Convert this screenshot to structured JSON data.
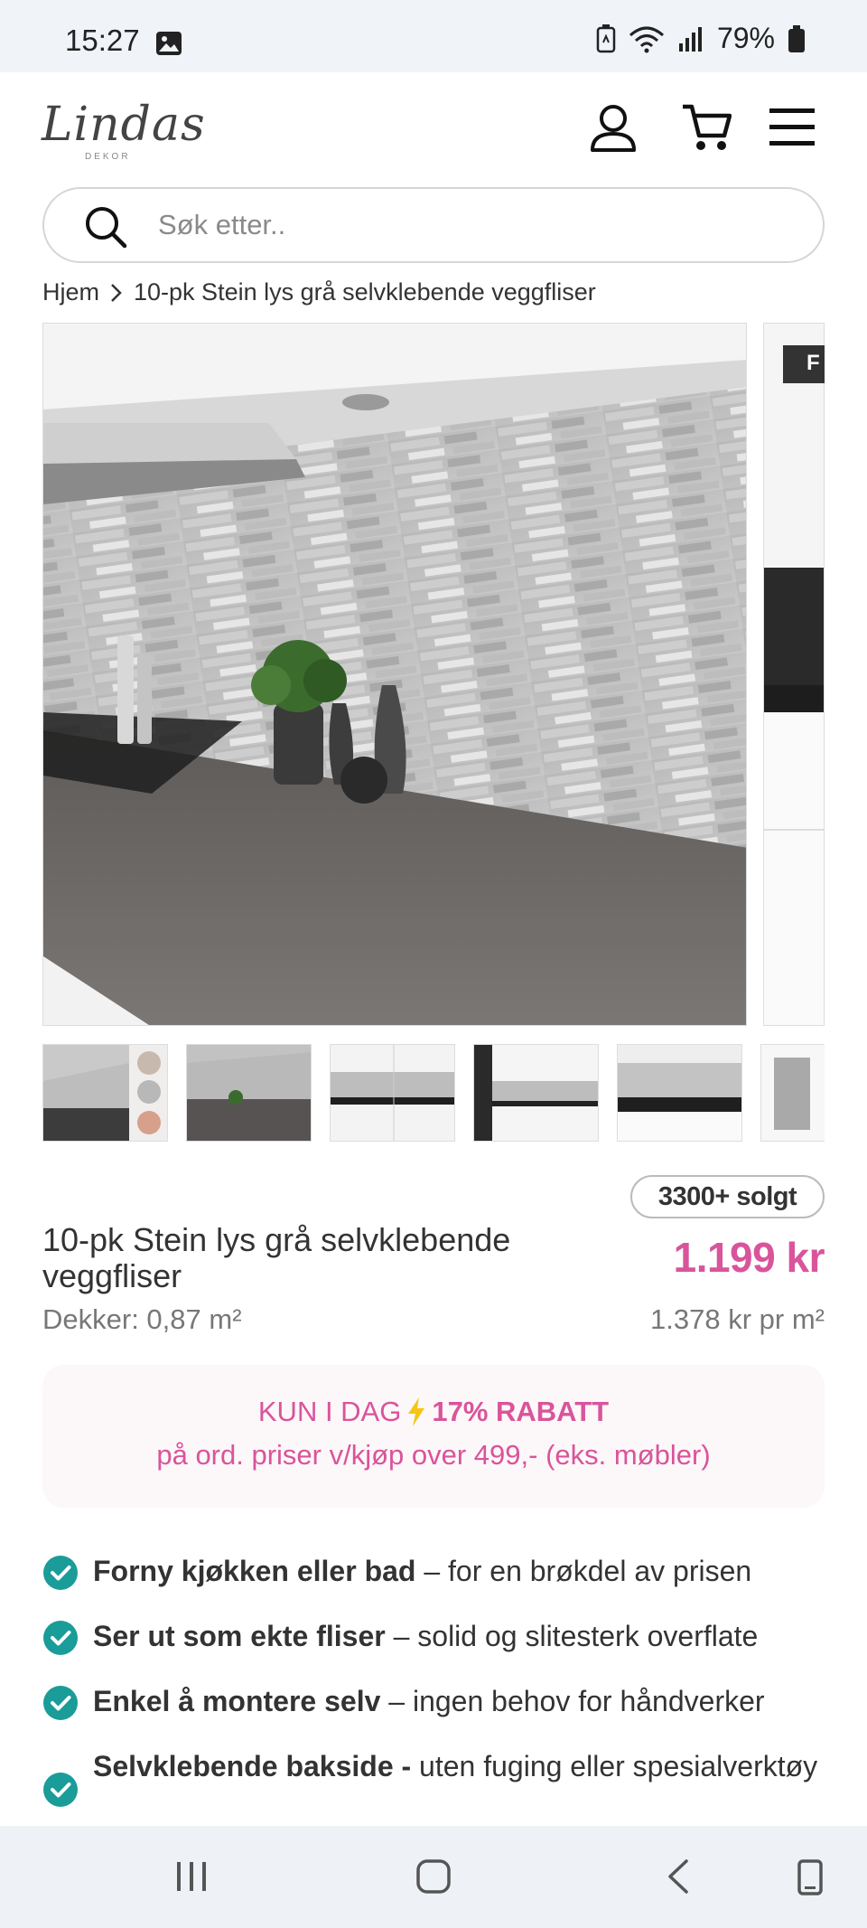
{
  "status_bar": {
    "time": "15:27",
    "battery": "79%"
  },
  "header": {
    "logo_text": "Lindas",
    "logo_sub": "DEKOR"
  },
  "search": {
    "placeholder": "Søk etter.."
  },
  "breadcrumb": {
    "home": "Hjem",
    "current": "10-pk Stein lys grå selvklebende veggfliser"
  },
  "gallery": {
    "sale_tag": "F",
    "thumbnail_count": 6
  },
  "product": {
    "sold_badge": "3300+ solgt",
    "title": "10-pk Stein lys grå selvklebende veggfliser",
    "price": "1.199 kr",
    "coverage": "Dekker: 0,87 m²",
    "unit_price": "1.378 kr pr m²"
  },
  "promo": {
    "prefix": "KUN I DAG",
    "discount": "17% RABATT",
    "line2": "på ord. priser v/kjøp over 499,- (eks. møbler)"
  },
  "features": [
    {
      "bold": "Forny kjøkken eller bad",
      "text": " – for en brøkdel av prisen"
    },
    {
      "bold": "Ser ut som ekte fliser",
      "text": " – solid og slitesterk overflate"
    },
    {
      "bold": "Enkel å montere selv",
      "text": " – ingen behov for håndverker"
    },
    {
      "bold": "Selvklebende bakside -",
      "text": " uten fuging eller spesialverktøy"
    }
  ],
  "colors": {
    "accent": "#d9549b",
    "check": "#1a9c99",
    "promo_bg": "#fcf7f8"
  }
}
